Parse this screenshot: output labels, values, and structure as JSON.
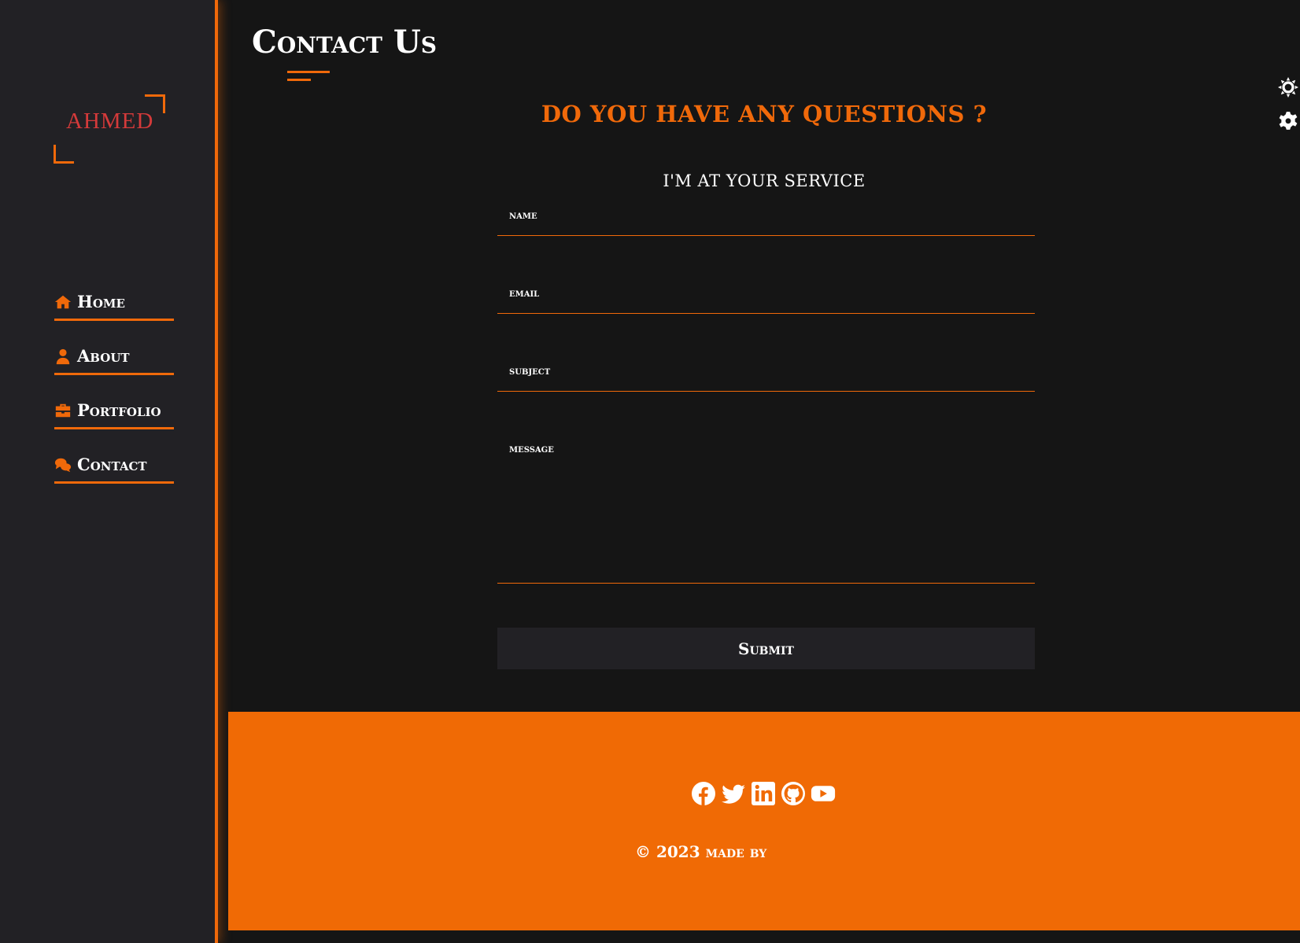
{
  "logo": {
    "text": "AHMED"
  },
  "nav": {
    "items": [
      {
        "label": "Home",
        "icon": "home-icon"
      },
      {
        "label": "About",
        "icon": "user-icon"
      },
      {
        "label": "Portfolio",
        "icon": "briefcase-icon"
      },
      {
        "label": "Contact",
        "icon": "chat-icon"
      }
    ]
  },
  "page": {
    "title": "Contact Us"
  },
  "contact": {
    "heading": "DO YOU HAVE ANY QUESTIONS ?",
    "subheading": "I'M AT YOUR SERVICE",
    "fields": {
      "name": "name",
      "email": "email",
      "subject": "subject",
      "message": "message"
    },
    "submit_label": "Submit"
  },
  "settings": {
    "icons": [
      "sun-icon",
      "gear-icon"
    ]
  },
  "footer": {
    "socials": [
      "facebook-icon",
      "twitter-icon",
      "linkedin-icon",
      "github-icon",
      "youtube-icon"
    ],
    "copyright": "© 2023 made by"
  },
  "colors": {
    "accent": "#f0690a",
    "sidebar_bg": "#222125",
    "main_bg": "#151515",
    "logo_text": "#d43a3a"
  }
}
